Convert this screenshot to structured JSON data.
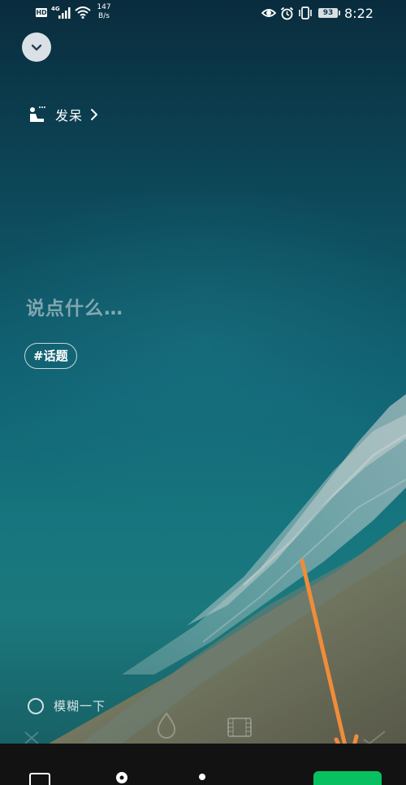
{
  "status_bar": {
    "hd": "HD",
    "network": "4G",
    "speed_value": "147",
    "speed_unit": "B/s",
    "battery": "93",
    "time": "8:22",
    "icons": [
      "signal-icon",
      "wifi-icon",
      "eye-icon",
      "alarm-icon",
      "vibrate-icon",
      "battery-icon"
    ]
  },
  "header": {
    "collapse_icon": "chevron-down-icon"
  },
  "mood": {
    "icon": "person-sitting-icon",
    "label": "发呆",
    "chevron": "chevron-right-icon"
  },
  "composer": {
    "placeholder": "说点什么…",
    "topic_chip": "#话题"
  },
  "blur_option": {
    "label": "模糊一下",
    "checked": false
  },
  "tools": [
    "close-icon",
    "drop-icon",
    "film-icon",
    "check-icon"
  ],
  "bottom_bar": {
    "icons": [
      "image-icon",
      "location-icon",
      "person-icon"
    ],
    "publish_color": "#07c160"
  },
  "annotation": {
    "color": "#f08c3a"
  }
}
